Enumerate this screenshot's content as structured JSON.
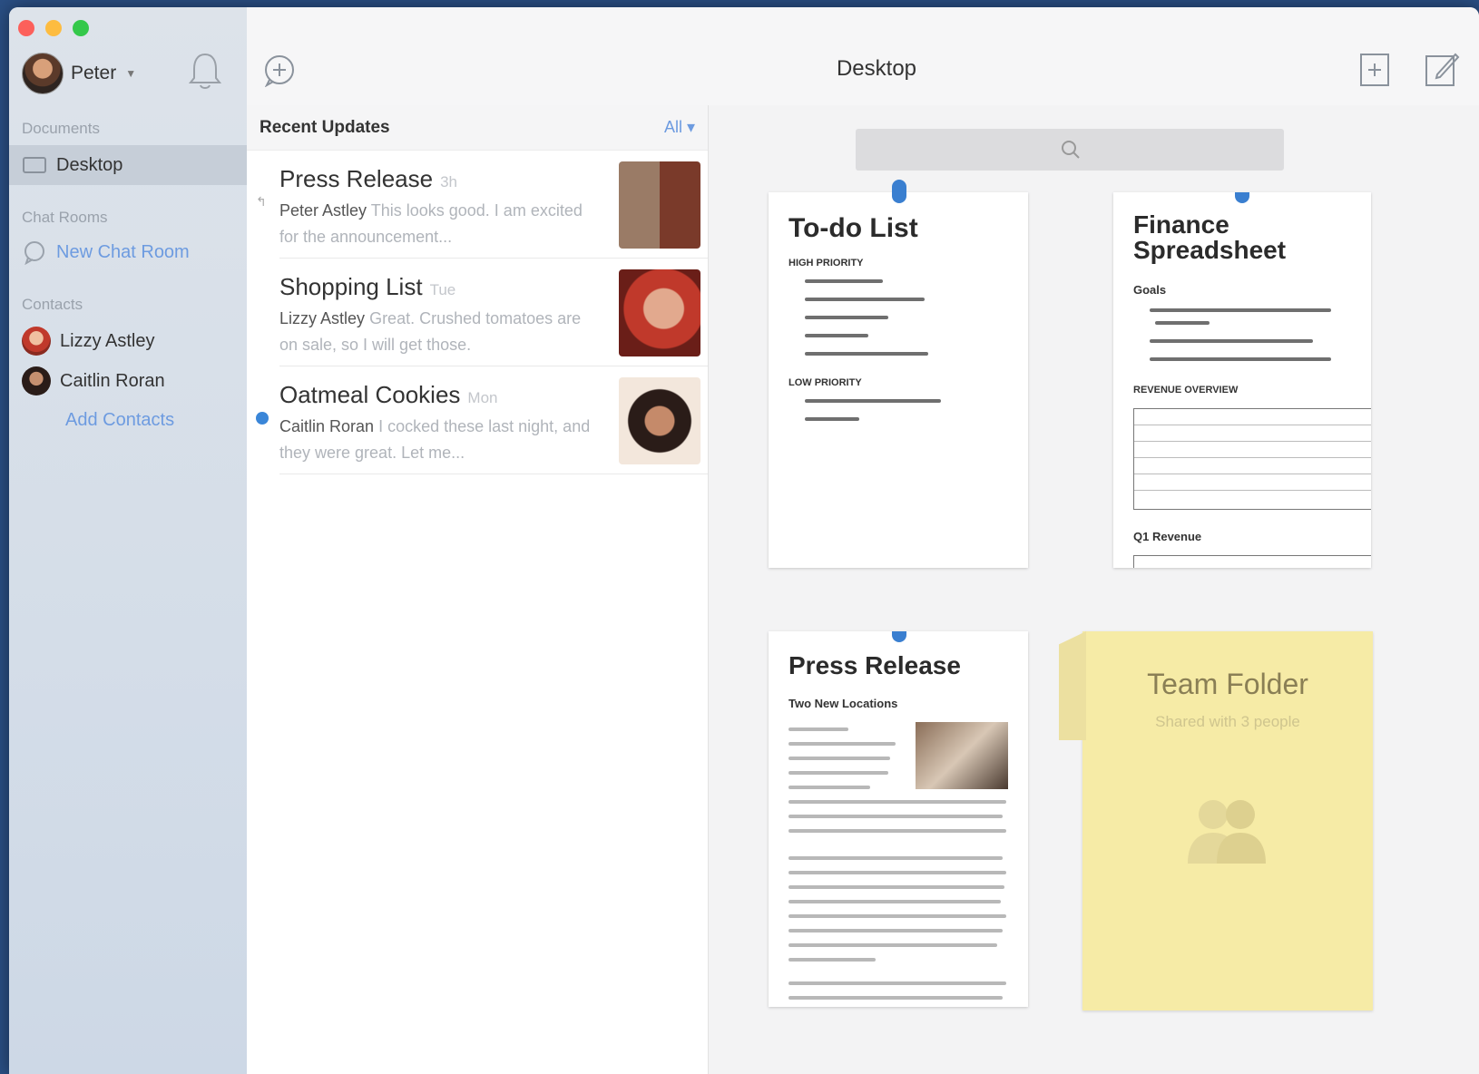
{
  "window": {
    "title": "Desktop"
  },
  "sidebar": {
    "user": "Peter",
    "sections": {
      "documents": "Documents",
      "chat_rooms": "Chat Rooms",
      "contacts": "Contacts"
    },
    "documents": [
      {
        "label": "Desktop"
      }
    ],
    "chat_rooms": [
      {
        "label": "New Chat Room"
      }
    ],
    "contacts": [
      {
        "label": "Lizzy Astley"
      },
      {
        "label": "Caitlin Roran"
      }
    ],
    "add_contacts": "Add Contacts"
  },
  "updates": {
    "header": "Recent Updates",
    "filter": "All",
    "items": [
      {
        "title": "Press Release",
        "time": "3h",
        "author": "Peter Astley",
        "text": "This looks good. I am excited for the announcement..."
      },
      {
        "title": "Shopping List",
        "time": "Tue",
        "author": "Lizzy Astley",
        "text": "Great. Crushed tomatoes are on sale, so I will get those."
      },
      {
        "title": "Oatmeal Cookies",
        "time": "Mon",
        "author": "Caitlin Roran",
        "text": "I cocked these last night, and they were great. Let me..."
      }
    ]
  },
  "documents": {
    "todo": {
      "title": "To-do List",
      "high": "HIGH PRIORITY",
      "low": "LOW PRIORITY"
    },
    "finance": {
      "title": "Finance Spreadsheet",
      "goals": "Goals",
      "overview": "REVENUE OVERVIEW",
      "q_revenue": "Q1 Revenue"
    },
    "press": {
      "title": "Press Release",
      "subtitle": "Two New Locations"
    },
    "folder": {
      "title": "Team Folder",
      "subtitle": "Shared with 3 people"
    }
  },
  "colors": {
    "accent": "#6d9be0",
    "unread_dot": "#3a86d8",
    "folder": "#f6eba6"
  }
}
